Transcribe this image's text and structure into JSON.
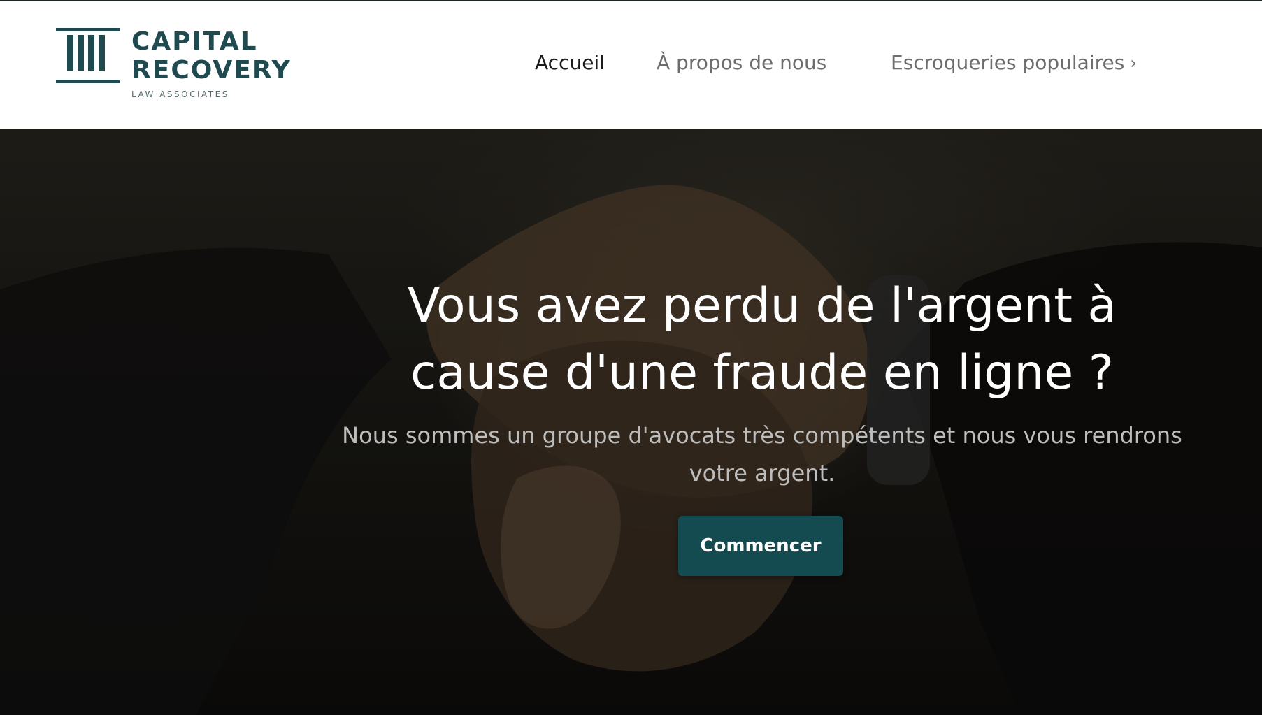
{
  "brand": {
    "line1": "CAPITAL",
    "line2": "RECOVERY",
    "line3": "LAW ASSOCIATES",
    "color": "#1f4a4f"
  },
  "nav": {
    "items": [
      {
        "label": "Accueil",
        "active": true
      },
      {
        "label": "À propos de nous",
        "active": false
      },
      {
        "label": "Escroqueries populaires",
        "active": false,
        "icon": "chevron-right-icon",
        "glyph": "›"
      }
    ]
  },
  "hero": {
    "title_line1": "Vous avez perdu de l'argent à",
    "title_line2": "cause d'une fraude en ligne ?",
    "subtitle_line1": "Nous sommes un groupe d'avocats très compétents et nous vous rendrons",
    "subtitle_line2": "votre argent.",
    "cta_label": "Commencer",
    "cta_color": "#134b50"
  }
}
